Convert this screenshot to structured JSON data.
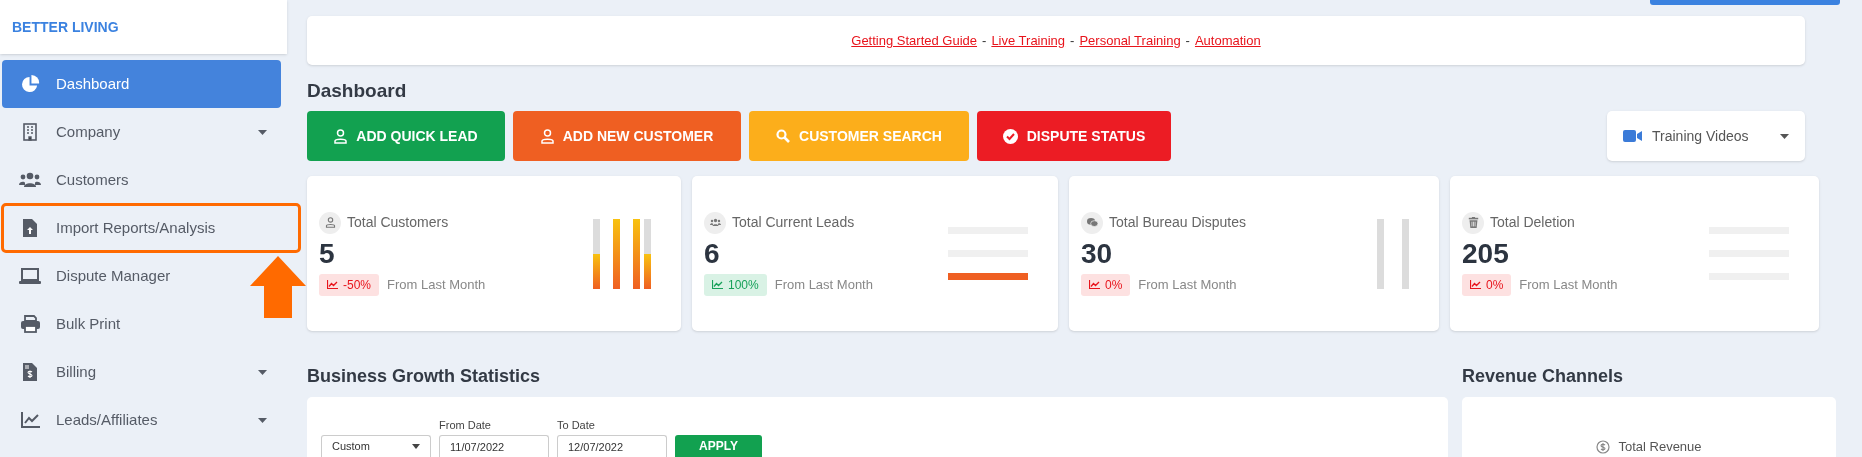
{
  "brand": "BETTER LIVING",
  "sidebar": {
    "items": [
      {
        "label": "Dashboard",
        "selected": true,
        "has_submenu": false,
        "annotated": false
      },
      {
        "label": "Company",
        "selected": false,
        "has_submenu": true,
        "annotated": false
      },
      {
        "label": "Customers",
        "selected": false,
        "has_submenu": false,
        "annotated": false
      },
      {
        "label": "Import Reports/Analysis",
        "selected": false,
        "has_submenu": false,
        "annotated": true
      },
      {
        "label": "Dispute Manager",
        "selected": false,
        "has_submenu": false,
        "annotated": false
      },
      {
        "label": "Bulk Print",
        "selected": false,
        "has_submenu": false,
        "annotated": false
      },
      {
        "label": "Billing",
        "selected": false,
        "has_submenu": true,
        "annotated": false
      },
      {
        "label": "Leads/Affiliates",
        "selected": false,
        "has_submenu": true,
        "annotated": false
      }
    ]
  },
  "top_links": {
    "items": [
      "Getting Started Guide",
      "Live Training",
      "Personal Training",
      "Automation"
    ],
    "separators": [
      "-",
      "-",
      "-"
    ]
  },
  "page_title": "Dashboard",
  "actions": [
    {
      "label": "ADD QUICK LEAD",
      "color": "#12a150"
    },
    {
      "label": "ADD NEW CUSTOMER",
      "color": "#ef5f22"
    },
    {
      "label": "CUSTOMER SEARCH",
      "color": "#fcae1b"
    },
    {
      "label": "DISPUTE STATUS",
      "color": "#ec1c24"
    }
  ],
  "training_dropdown": {
    "label": "Training Videos"
  },
  "stats": [
    {
      "title": "Total Customers",
      "value": "5",
      "change": "-50%",
      "kind": "decrease",
      "caption": "From Last Month"
    },
    {
      "title": "Total Current Leads",
      "value": "6",
      "change": "100%",
      "kind": "increase",
      "caption": "From Last Month"
    },
    {
      "title": "Total Bureau Disputes",
      "value": "30",
      "change": "0%",
      "kind": "decrease",
      "caption": "From Last Month"
    },
    {
      "title": "Total Deletion",
      "value": "205",
      "change": "0%",
      "kind": "decrease",
      "caption": "From Last Month"
    }
  ],
  "growth": {
    "title": "Business Growth Statistics",
    "range": {
      "value": "Custom"
    },
    "from": {
      "label": "From Date",
      "value": "11/07/2022"
    },
    "to": {
      "label": "To Date",
      "value": "12/07/2022"
    },
    "apply": "APPLY"
  },
  "revenue": {
    "title": "Revenue Channels",
    "item": "Total Revenue"
  }
}
